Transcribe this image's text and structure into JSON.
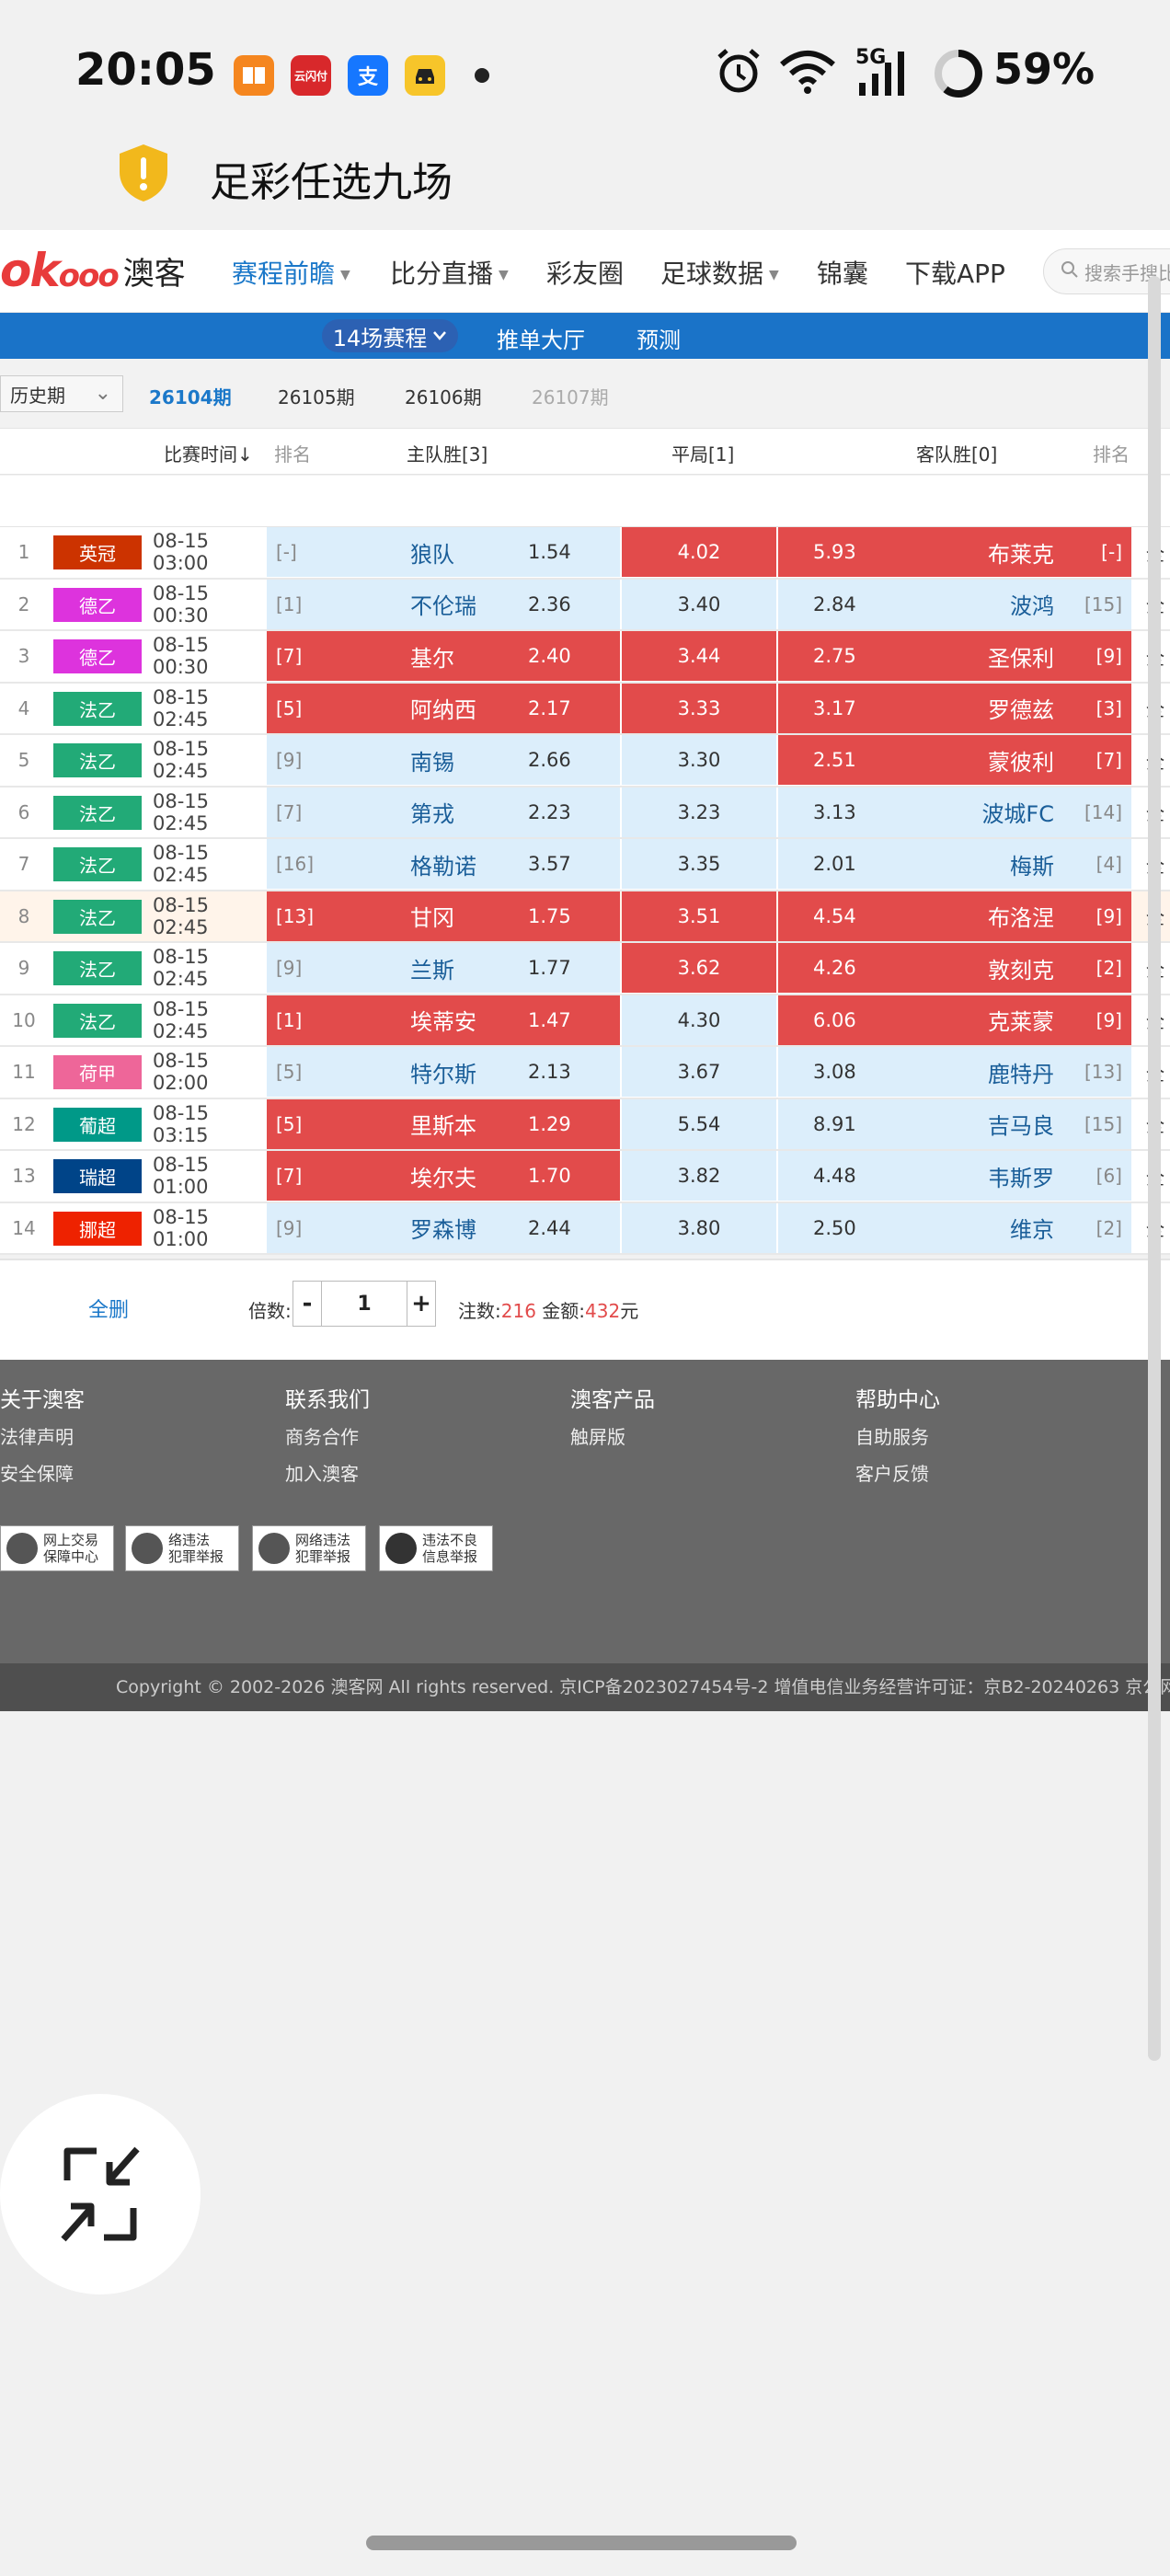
{
  "status_bar": {
    "time": "20:05",
    "apps": [
      {
        "icon": "book-app-icon",
        "color": "#f5861f"
      },
      {
        "icon": "yunshanfu-app-icon",
        "label": "云闪付",
        "color": "#d8282b"
      },
      {
        "icon": "alipay-app-icon",
        "label": "支",
        "color": "#1677ff"
      },
      {
        "icon": "car-app-icon",
        "color": "#f7c52a"
      }
    ],
    "network": "5G",
    "battery": "59%"
  },
  "page_title": "足彩任选九场",
  "nav": {
    "logo_text": "澳客",
    "items": [
      {
        "label": "赛程前瞻",
        "active": true,
        "dropdown": true
      },
      {
        "label": "比分直播",
        "dropdown": true
      },
      {
        "label": "彩友圈"
      },
      {
        "label": "足球数据",
        "dropdown": true
      },
      {
        "label": "锦囊"
      },
      {
        "label": "下载APP"
      }
    ],
    "search_placeholder": "搜索手搜比"
  },
  "subnav": {
    "selected": "14场赛程",
    "items": [
      "推单大厅",
      "预测"
    ]
  },
  "issues": {
    "history_label": "历史期",
    "list": [
      {
        "label": "26104期",
        "state": "active"
      },
      {
        "label": "26105期",
        "state": "normal"
      },
      {
        "label": "26106期",
        "state": "normal"
      },
      {
        "label": "26107期",
        "state": "disabled"
      }
    ]
  },
  "table_header": {
    "time": "比赛时间↓",
    "rank_home": "排名",
    "home": "主队胜[3]",
    "draw": "平局[1]",
    "away": "客队胜[0]",
    "rank_away": "排名"
  },
  "matches": [
    {
      "n": "1",
      "league": "英冠",
      "league_color": "#cc3300",
      "time": "08-15 03:00",
      "home_rank": "[-]",
      "home": "狼队",
      "home_odds": "1.54",
      "draw": "4.02",
      "away_odds": "5.93",
      "away": "布莱克",
      "away_rank": "[-]",
      "sel": [
        false,
        true,
        true
      ],
      "all": "全"
    },
    {
      "n": "2",
      "league": "德乙",
      "league_color": "#dd33dd",
      "time": "08-15 00:30",
      "home_rank": "[1]",
      "home": "不伦瑞",
      "home_odds": "2.36",
      "draw": "3.40",
      "away_odds": "2.84",
      "away": "波鸿",
      "away_rank": "[15]",
      "sel": [
        false,
        false,
        false
      ],
      "all": "全"
    },
    {
      "n": "3",
      "league": "德乙",
      "league_color": "#dd33dd",
      "time": "08-15 00:30",
      "home_rank": "[7]",
      "home": "基尔",
      "home_odds": "2.40",
      "draw": "3.44",
      "away_odds": "2.75",
      "away": "圣保利",
      "away_rank": "[9]",
      "sel": [
        true,
        true,
        true
      ],
      "all": "全"
    },
    {
      "n": "4",
      "league": "法乙",
      "league_color": "#22aa77",
      "time": "08-15 02:45",
      "home_rank": "[5]",
      "home": "阿纳西",
      "home_odds": "2.17",
      "draw": "3.33",
      "away_odds": "3.17",
      "away": "罗德兹",
      "away_rank": "[3]",
      "sel": [
        true,
        true,
        true
      ],
      "all": "全"
    },
    {
      "n": "5",
      "league": "法乙",
      "league_color": "#22aa77",
      "time": "08-15 02:45",
      "home_rank": "[9]",
      "home": "南锡",
      "home_odds": "2.66",
      "draw": "3.30",
      "away_odds": "2.51",
      "away": "蒙彼利",
      "away_rank": "[7]",
      "sel": [
        false,
        false,
        true
      ],
      "all": "全"
    },
    {
      "n": "6",
      "league": "法乙",
      "league_color": "#22aa77",
      "time": "08-15 02:45",
      "home_rank": "[7]",
      "home": "第戎",
      "home_odds": "2.23",
      "draw": "3.23",
      "away_odds": "3.13",
      "away": "波城FC",
      "away_rank": "[14]",
      "sel": [
        false,
        false,
        false
      ],
      "all": "全"
    },
    {
      "n": "7",
      "league": "法乙",
      "league_color": "#22aa77",
      "time": "08-15 02:45",
      "home_rank": "[16]",
      "home": "格勒诺",
      "home_odds": "3.57",
      "draw": "3.35",
      "away_odds": "2.01",
      "away": "梅斯",
      "away_rank": "[4]",
      "sel": [
        false,
        false,
        false
      ],
      "all": "全"
    },
    {
      "n": "8",
      "league": "法乙",
      "league_color": "#22aa77",
      "time": "08-15 02:45",
      "home_rank": "[13]",
      "home": "甘冈",
      "home_odds": "1.75",
      "draw": "3.51",
      "away_odds": "4.54",
      "away": "布洛涅",
      "away_rank": "[9]",
      "sel": [
        true,
        true,
        true
      ],
      "all": "全",
      "highlight": true
    },
    {
      "n": "9",
      "league": "法乙",
      "league_color": "#22aa77",
      "time": "08-15 02:45",
      "home_rank": "[9]",
      "home": "兰斯",
      "home_odds": "1.77",
      "draw": "3.62",
      "away_odds": "4.26",
      "away": "敦刻克",
      "away_rank": "[2]",
      "sel": [
        false,
        true,
        true
      ],
      "all": "全"
    },
    {
      "n": "10",
      "league": "法乙",
      "league_color": "#22aa77",
      "time": "08-15 02:45",
      "home_rank": "[1]",
      "home": "埃蒂安",
      "home_odds": "1.47",
      "draw": "4.30",
      "away_odds": "6.06",
      "away": "克莱蒙",
      "away_rank": "[9]",
      "sel": [
        true,
        false,
        true
      ],
      "all": "全"
    },
    {
      "n": "11",
      "league": "荷甲",
      "league_color": "#ee6699",
      "time": "08-15 02:00",
      "home_rank": "[5]",
      "home": "特尔斯",
      "home_odds": "2.13",
      "draw": "3.67",
      "away_odds": "3.08",
      "away": "鹿特丹",
      "away_rank": "[13]",
      "sel": [
        false,
        false,
        false
      ],
      "all": "全"
    },
    {
      "n": "12",
      "league": "葡超",
      "league_color": "#009988",
      "time": "08-15 03:15",
      "home_rank": "[5]",
      "home": "里斯本",
      "home_odds": "1.29",
      "draw": "5.54",
      "away_odds": "8.91",
      "away": "吉马良",
      "away_rank": "[15]",
      "sel": [
        true,
        false,
        false
      ],
      "all": "全"
    },
    {
      "n": "13",
      "league": "瑞超",
      "league_color": "#004488",
      "time": "08-15 01:00",
      "home_rank": "[7]",
      "home": "埃尔夫",
      "home_odds": "1.70",
      "draw": "3.82",
      "away_odds": "4.48",
      "away": "韦斯罗",
      "away_rank": "[6]",
      "sel": [
        true,
        false,
        false
      ],
      "all": "全"
    },
    {
      "n": "14",
      "league": "挪超",
      "league_color": "#ee2200",
      "time": "08-15 01:00",
      "home_rank": "[9]",
      "home": "罗森博",
      "home_odds": "2.44",
      "draw": "3.80",
      "away_odds": "2.50",
      "away": "维京",
      "away_rank": "[2]",
      "sel": [
        false,
        false,
        false
      ],
      "all": "全"
    }
  ],
  "bottom_bar": {
    "clear_all": "全删",
    "multiplier_label": "倍数:",
    "minus": "-",
    "multiplier": "1",
    "plus": "+",
    "bets_label": "注数:",
    "bets": "216",
    "amount_label": "金额:",
    "amount": "432",
    "currency": "元"
  },
  "footer": {
    "columns": [
      {
        "title": "关于澳客",
        "links": [
          "法律声明",
          "安全保障"
        ]
      },
      {
        "title": "联系我们",
        "links": [
          "商务合作",
          "加入澳客"
        ]
      },
      {
        "title": "澳客产品",
        "links": [
          "触屏版"
        ]
      },
      {
        "title": "帮助中心",
        "links": [
          "自助服务",
          "客户反馈"
        ]
      }
    ],
    "badges": [
      {
        "line1": "网上交易",
        "line2": "保障中心"
      },
      {
        "line1": "络违法",
        "line2": "犯罪举报"
      },
      {
        "line1": "网络违法",
        "line2": "犯罪举报"
      },
      {
        "line1": "违法不良",
        "line2": "信息举报"
      }
    ],
    "copyright": "Copyright © 2002-2026 澳客网  All rights reserved.    京ICP备2023027454号-2  增值电信业务经营许可证：京B2-20240263  京公网"
  },
  "fab_icon": "exit-fullscreen-icon",
  "colors": {
    "selected": "#e24b4b",
    "cell_bg": "#dceefb",
    "accent": "#1b78c9",
    "subnav": "#1a73c8"
  }
}
